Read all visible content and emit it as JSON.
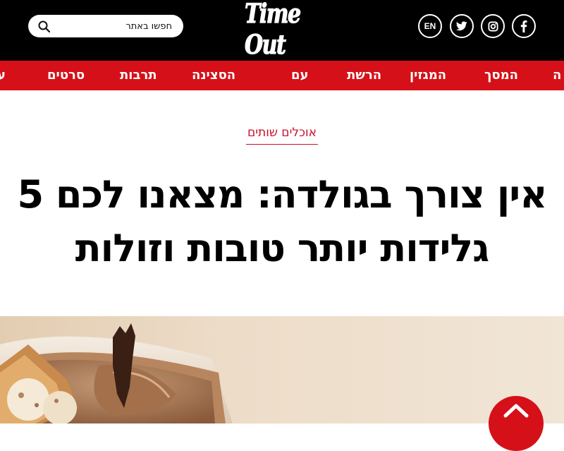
{
  "header": {
    "logo_text": "Time Out",
    "search": {
      "placeholder": "חפשו באתר",
      "icon": "search-icon"
    },
    "social": [
      {
        "label": "EN",
        "icon": "language-switch"
      },
      {
        "icon": "twitter-icon"
      },
      {
        "icon": "instagram-icon"
      },
      {
        "icon": "facebook-icon"
      }
    ]
  },
  "nav": {
    "items": [
      "ה",
      "המסך",
      "המגזין",
      "הרשת",
      "עם",
      "הסצינה",
      "תרבות",
      "סרטים",
      "ע"
    ]
  },
  "article": {
    "category": "אוכלים שותים",
    "title": "אין צורך בגולדה: מצאנו לכם 5 גלידות יותר טובות וזולות"
  },
  "colors": {
    "header_bg": "#000000",
    "nav_bg": "#d51018",
    "accent": "#c8102e"
  }
}
